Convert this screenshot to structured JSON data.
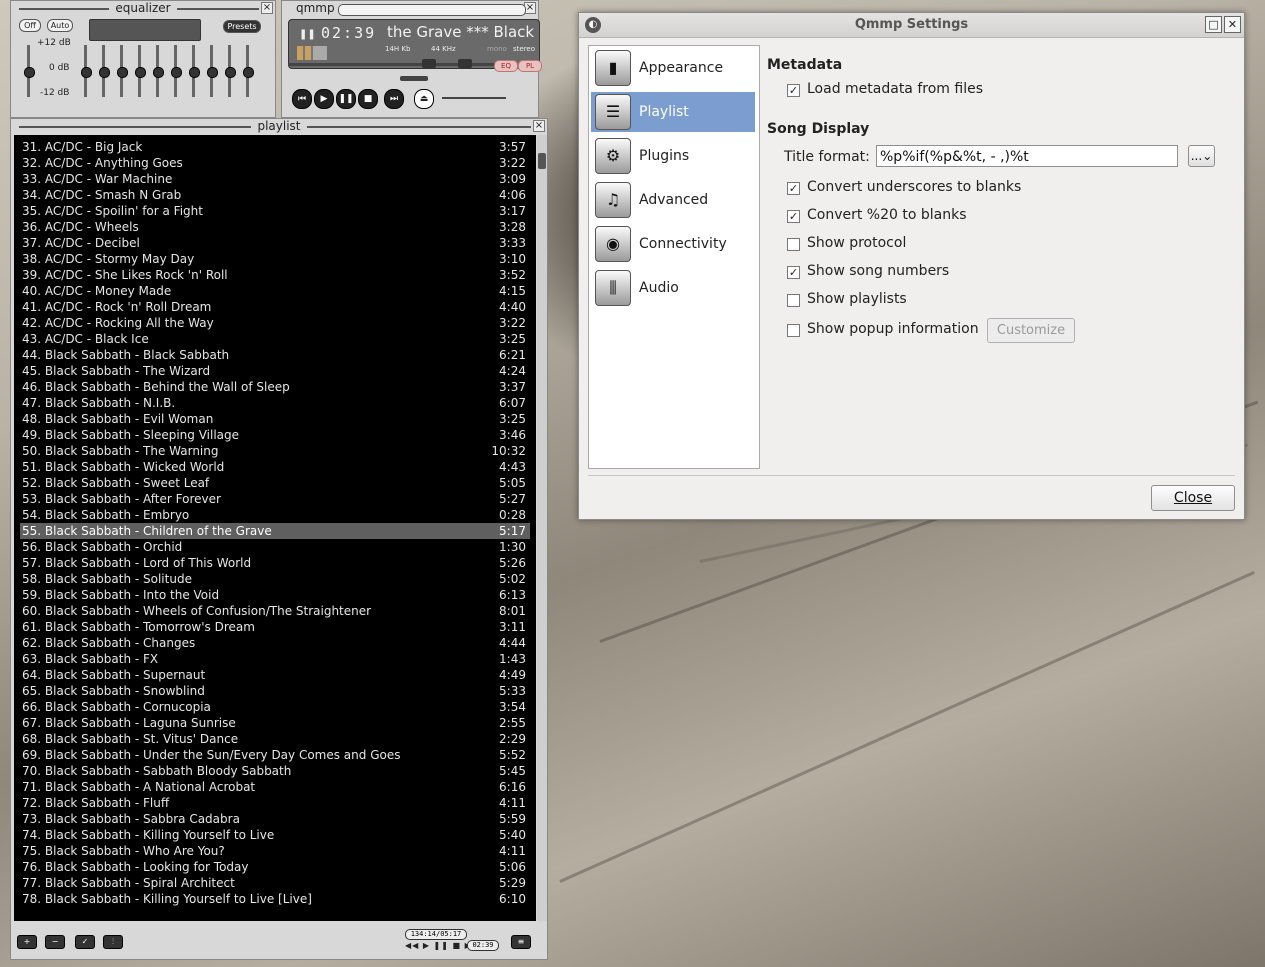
{
  "equalizer": {
    "title": "equalizer",
    "off_label": "Off",
    "auto_label": "Auto",
    "presets_label": "Presets",
    "db_top": "+12 dB",
    "db_mid": "0 dB",
    "db_bot": "-12 dB"
  },
  "player": {
    "title": "qmmp",
    "time": "02:39",
    "song_marquee": "the Grave   *** Black",
    "bitrate": "14H Kb",
    "samplerate": "44 KHz",
    "mono": "mono",
    "stereo": "stereo",
    "eq_label": "EQ",
    "pl_label": "PL"
  },
  "playlist": {
    "title": "playlist",
    "footer_time": "134:14/05:17",
    "footer_time2": "02:39",
    "selected_index": 24,
    "rows": [
      {
        "title": "31. AC/DC - Big Jack",
        "dur": "3:57"
      },
      {
        "title": "32. AC/DC - Anything Goes",
        "dur": "3:22"
      },
      {
        "title": "33. AC/DC - War Machine",
        "dur": "3:09"
      },
      {
        "title": "34. AC/DC - Smash N Grab",
        "dur": "4:06"
      },
      {
        "title": "35. AC/DC - Spoilin' for a Fight",
        "dur": "3:17"
      },
      {
        "title": "36. AC/DC - Wheels",
        "dur": "3:28"
      },
      {
        "title": "37. AC/DC - Decibel",
        "dur": "3:33"
      },
      {
        "title": "38. AC/DC - Stormy May Day",
        "dur": "3:10"
      },
      {
        "title": "39. AC/DC - She Likes Rock 'n' Roll",
        "dur": "3:52"
      },
      {
        "title": "40. AC/DC - Money Made",
        "dur": "4:15"
      },
      {
        "title": "41. AC/DC - Rock 'n' Roll Dream",
        "dur": "4:40"
      },
      {
        "title": "42. AC/DC - Rocking All the Way",
        "dur": "3:22"
      },
      {
        "title": "43. AC/DC - Black Ice",
        "dur": "3:25"
      },
      {
        "title": "44. Black Sabbath - Black Sabbath",
        "dur": "6:21"
      },
      {
        "title": "45. Black Sabbath - The Wizard",
        "dur": "4:24"
      },
      {
        "title": "46. Black Sabbath - Behind the Wall of Sleep",
        "dur": "3:37"
      },
      {
        "title": "47. Black Sabbath - N.I.B.",
        "dur": "6:07"
      },
      {
        "title": "48. Black Sabbath - Evil Woman",
        "dur": "3:25"
      },
      {
        "title": "49. Black Sabbath - Sleeping Village",
        "dur": "3:46"
      },
      {
        "title": "50. Black Sabbath - The Warning",
        "dur": "10:32"
      },
      {
        "title": "51. Black Sabbath - Wicked World",
        "dur": "4:43"
      },
      {
        "title": "52. Black Sabbath - Sweet Leaf",
        "dur": "5:05"
      },
      {
        "title": "53. Black Sabbath - After Forever",
        "dur": "5:27"
      },
      {
        "title": "54. Black Sabbath - Embryo",
        "dur": "0:28"
      },
      {
        "title": "55. Black Sabbath - Children of the Grave",
        "dur": "5:17"
      },
      {
        "title": "56. Black Sabbath - Orchid",
        "dur": "1:30"
      },
      {
        "title": "57. Black Sabbath - Lord of This World",
        "dur": "5:26"
      },
      {
        "title": "58. Black Sabbath - Solitude",
        "dur": "5:02"
      },
      {
        "title": "59. Black Sabbath - Into the Void",
        "dur": "6:13"
      },
      {
        "title": "60. Black Sabbath - Wheels of Confusion/The Straightener",
        "dur": "8:01"
      },
      {
        "title": "61. Black Sabbath - Tomorrow's Dream",
        "dur": "3:11"
      },
      {
        "title": "62. Black Sabbath - Changes",
        "dur": "4:44"
      },
      {
        "title": "63. Black Sabbath - FX",
        "dur": "1:43"
      },
      {
        "title": "64. Black Sabbath - Supernaut",
        "dur": "4:49"
      },
      {
        "title": "65. Black Sabbath - Snowblind",
        "dur": "5:33"
      },
      {
        "title": "66. Black Sabbath - Cornucopia",
        "dur": "3:54"
      },
      {
        "title": "67. Black Sabbath - Laguna Sunrise",
        "dur": "2:55"
      },
      {
        "title": "68. Black Sabbath - St. Vitus' Dance",
        "dur": "2:29"
      },
      {
        "title": "69. Black Sabbath - Under the Sun/Every Day Comes and Goes",
        "dur": "5:52"
      },
      {
        "title": "70. Black Sabbath - Sabbath Bloody Sabbath",
        "dur": "5:45"
      },
      {
        "title": "71. Black Sabbath - A National Acrobat",
        "dur": "6:16"
      },
      {
        "title": "72. Black Sabbath - Fluff",
        "dur": "4:11"
      },
      {
        "title": "73. Black Sabbath - Sabbra Cadabra",
        "dur": "5:59"
      },
      {
        "title": "74. Black Sabbath - Killing Yourself to Live",
        "dur": "5:40"
      },
      {
        "title": "75. Black Sabbath - Who Are You?",
        "dur": "4:11"
      },
      {
        "title": "76. Black Sabbath - Looking for Today",
        "dur": "5:06"
      },
      {
        "title": "77. Black Sabbath - Spiral Architect",
        "dur": "5:29"
      },
      {
        "title": "78. Black Sabbath - Killing Yourself to Live [Live]",
        "dur": "6:10"
      }
    ]
  },
  "settings": {
    "title": "Qmmp Settings",
    "sidebar": [
      {
        "label": "Appearance",
        "icon": "appearance-icon",
        "glyph": "▮"
      },
      {
        "label": "Playlist",
        "icon": "playlist-icon",
        "glyph": "☰"
      },
      {
        "label": "Plugins",
        "icon": "plugins-icon",
        "glyph": "⚙"
      },
      {
        "label": "Advanced",
        "icon": "advanced-icon",
        "glyph": "♫"
      },
      {
        "label": "Connectivity",
        "icon": "connectivity-icon",
        "glyph": "◉"
      },
      {
        "label": "Audio",
        "icon": "audio-icon",
        "glyph": "⫼"
      }
    ],
    "selected_sidebar": 1,
    "metadata_heading": "Metadata",
    "load_metadata": {
      "label": "Load metadata from files",
      "checked": true
    },
    "song_display_heading": "Song Display",
    "title_format_label": "Title format:",
    "title_format_value": "%p%if(%p&%t, - ,)%t",
    "dots_button": "...",
    "options": [
      {
        "label": "Convert underscores to blanks",
        "checked": true
      },
      {
        "label": "Convert %20 to blanks",
        "checked": true
      },
      {
        "label": "Show protocol",
        "checked": false
      },
      {
        "label": "Show song numbers",
        "checked": true
      },
      {
        "label": "Show playlists",
        "checked": false
      },
      {
        "label": "Show popup information",
        "checked": false
      }
    ],
    "customize_button": "Customize",
    "close_button": "Close"
  },
  "colors": {
    "selection": "#7b9dd0",
    "playlist_bg": "#000000",
    "playlist_selected_row": "#5f5f5f"
  }
}
